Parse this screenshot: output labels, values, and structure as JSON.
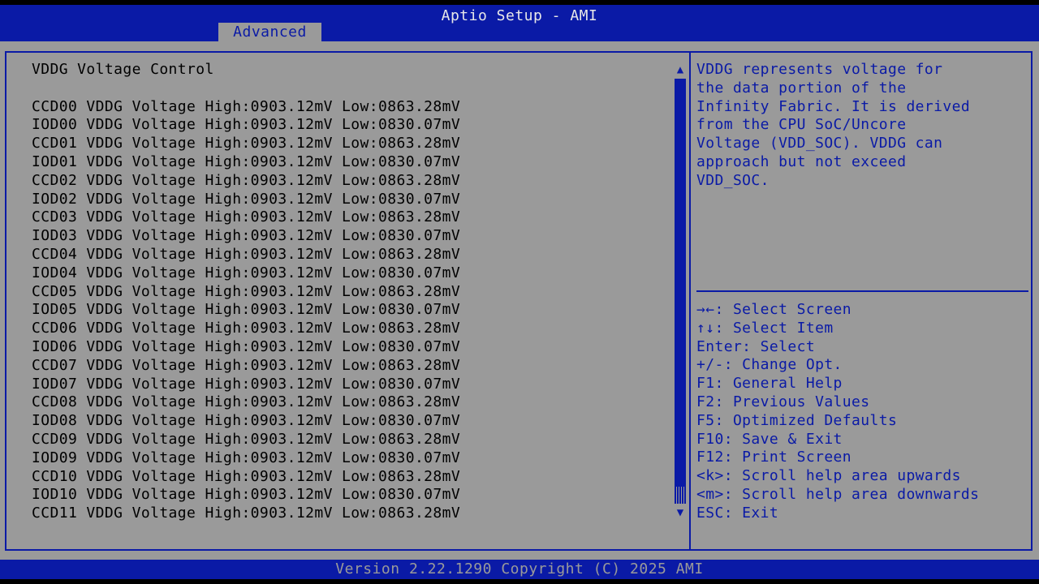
{
  "app": {
    "title": "Aptio Setup - AMI",
    "active_tab": "Advanced"
  },
  "main": {
    "section_title": "VDDG Voltage Control",
    "rows": [
      "CCD00 VDDG Voltage High:0903.12mV Low:0863.28mV",
      "IOD00 VDDG Voltage High:0903.12mV Low:0830.07mV",
      "CCD01 VDDG Voltage High:0903.12mV Low:0863.28mV",
      "IOD01 VDDG Voltage High:0903.12mV Low:0830.07mV",
      "CCD02 VDDG Voltage High:0903.12mV Low:0863.28mV",
      "IOD02 VDDG Voltage High:0903.12mV Low:0830.07mV",
      "CCD03 VDDG Voltage High:0903.12mV Low:0863.28mV",
      "IOD03 VDDG Voltage High:0903.12mV Low:0830.07mV",
      "CCD04 VDDG Voltage High:0903.12mV Low:0863.28mV",
      "IOD04 VDDG Voltage High:0903.12mV Low:0830.07mV",
      "CCD05 VDDG Voltage High:0903.12mV Low:0863.28mV",
      "IOD05 VDDG Voltage High:0903.12mV Low:0830.07mV",
      "CCD06 VDDG Voltage High:0903.12mV Low:0863.28mV",
      "IOD06 VDDG Voltage High:0903.12mV Low:0830.07mV",
      "CCD07 VDDG Voltage High:0903.12mV Low:0863.28mV",
      "IOD07 VDDG Voltage High:0903.12mV Low:0830.07mV",
      "CCD08 VDDG Voltage High:0903.12mV Low:0863.28mV",
      "IOD08 VDDG Voltage High:0903.12mV Low:0830.07mV",
      "CCD09 VDDG Voltage High:0903.12mV Low:0863.28mV",
      "IOD09 VDDG Voltage High:0903.12mV Low:0830.07mV",
      "CCD10 VDDG Voltage High:0903.12mV Low:0863.28mV",
      "IOD10 VDDG Voltage High:0903.12mV Low:0830.07mV",
      "CCD11 VDDG Voltage High:0903.12mV Low:0863.28mV"
    ]
  },
  "help": {
    "lines": [
      "VDDG represents voltage for",
      "the data portion of the",
      "Infinity Fabric. It is derived",
      "from the CPU SoC/Uncore",
      "Voltage (VDD_SOC). VDDG can",
      "approach but not exceed",
      "VDD_SOC."
    ]
  },
  "keys": {
    "lines": [
      "→←: Select Screen",
      "↑↓: Select Item",
      "Enter: Select",
      "+/-: Change Opt.",
      "F1: General Help",
      "F2: Previous Values",
      "F5: Optimized Defaults",
      "F10: Save & Exit",
      "F12: Print Screen",
      "<k>: Scroll help area upwards",
      "<m>: Scroll help area downwards",
      "ESC: Exit"
    ]
  },
  "scrollbar": {
    "up_glyph": "▲",
    "down_glyph": "▼"
  },
  "footer": {
    "text": "Version 2.22.1290 Copyright (C) 2025 AMI"
  },
  "colors": {
    "bios_blue": "#0a1aa6",
    "bios_gray": "#9a9a9a",
    "text_black": "#000000"
  }
}
